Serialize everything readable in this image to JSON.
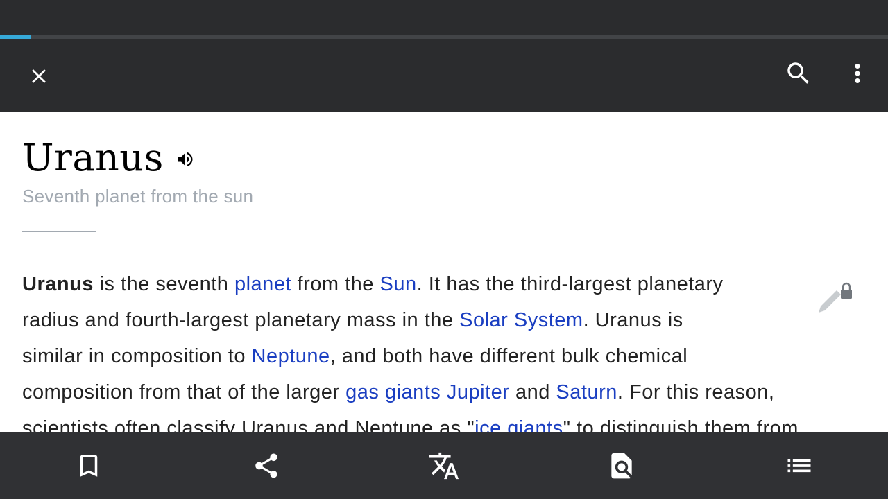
{
  "progress": {
    "fraction": 0.035,
    "color": "#36a9d8"
  },
  "top_bar": {
    "close_icon": "close-icon",
    "search_icon": "search-icon",
    "more_icon": "more-vert-icon"
  },
  "article": {
    "title": "Uranus",
    "description": "Seventh planet from the sun",
    "lead": {
      "s1_bold": "Uranus",
      "s1_a": " is the seventh ",
      "link_planet": "planet",
      "s1_b": " from the ",
      "link_sun": "Sun",
      "s1_c": ". It has the third-largest planetary",
      "s2_a": "radius and fourth-largest planetary mass in the ",
      "link_solar_system": "Solar System",
      "s2_b": ". Uranus is",
      "s3_a": "similar in composition to ",
      "link_neptune": "Neptune",
      "s3_b": ", and both have different bulk chemical",
      "s4_a": "composition from that of the larger ",
      "link_gas_giants": "gas giants Jupiter",
      "s4_b": " and ",
      "link_saturn": "Saturn",
      "s4_c": ". For this reason,",
      "s5_a": "scientists often classify Uranus and Neptune as \"",
      "link_ice_giants": "ice giants",
      "s5_b": "\" to distinguish them from"
    },
    "link_color": "#1a3ec1"
  },
  "bottom_bar": {
    "icons": [
      "bookmark-icon",
      "share-icon",
      "translate-icon",
      "find-in-page-icon",
      "contents-list-icon"
    ]
  }
}
